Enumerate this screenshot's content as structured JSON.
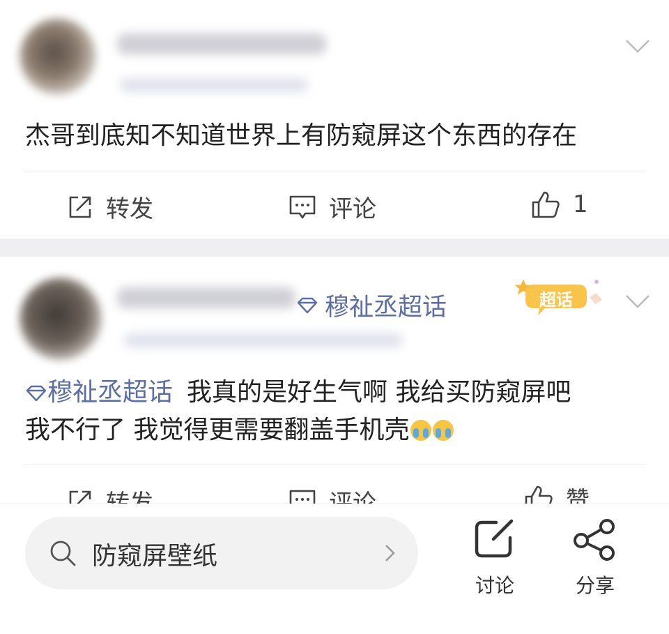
{
  "post1": {
    "text": "杰哥到底知不知道世界上有防窥屏这个东西的存在",
    "actions": {
      "repost": "转发",
      "comment": "评论",
      "like": "1"
    }
  },
  "post2": {
    "topic_chip": "穆祉丞超话",
    "badge": "超话",
    "text_topic": "穆祉丞超话",
    "text_line1": "我真的是好生气啊 我给买防窥屏吧",
    "text_line2": "我不行了 我觉得更需要翻盖手机壳",
    "actions": {
      "repost": "转发",
      "comment": "评论",
      "like": "赞"
    }
  },
  "bottom": {
    "search_text": "防窥屏壁纸",
    "discuss": "讨论",
    "share": "分享"
  },
  "colors": {
    "topic": "#5b6fa6",
    "badge": "#f5b83a",
    "divider_bg": "#efeff1"
  }
}
